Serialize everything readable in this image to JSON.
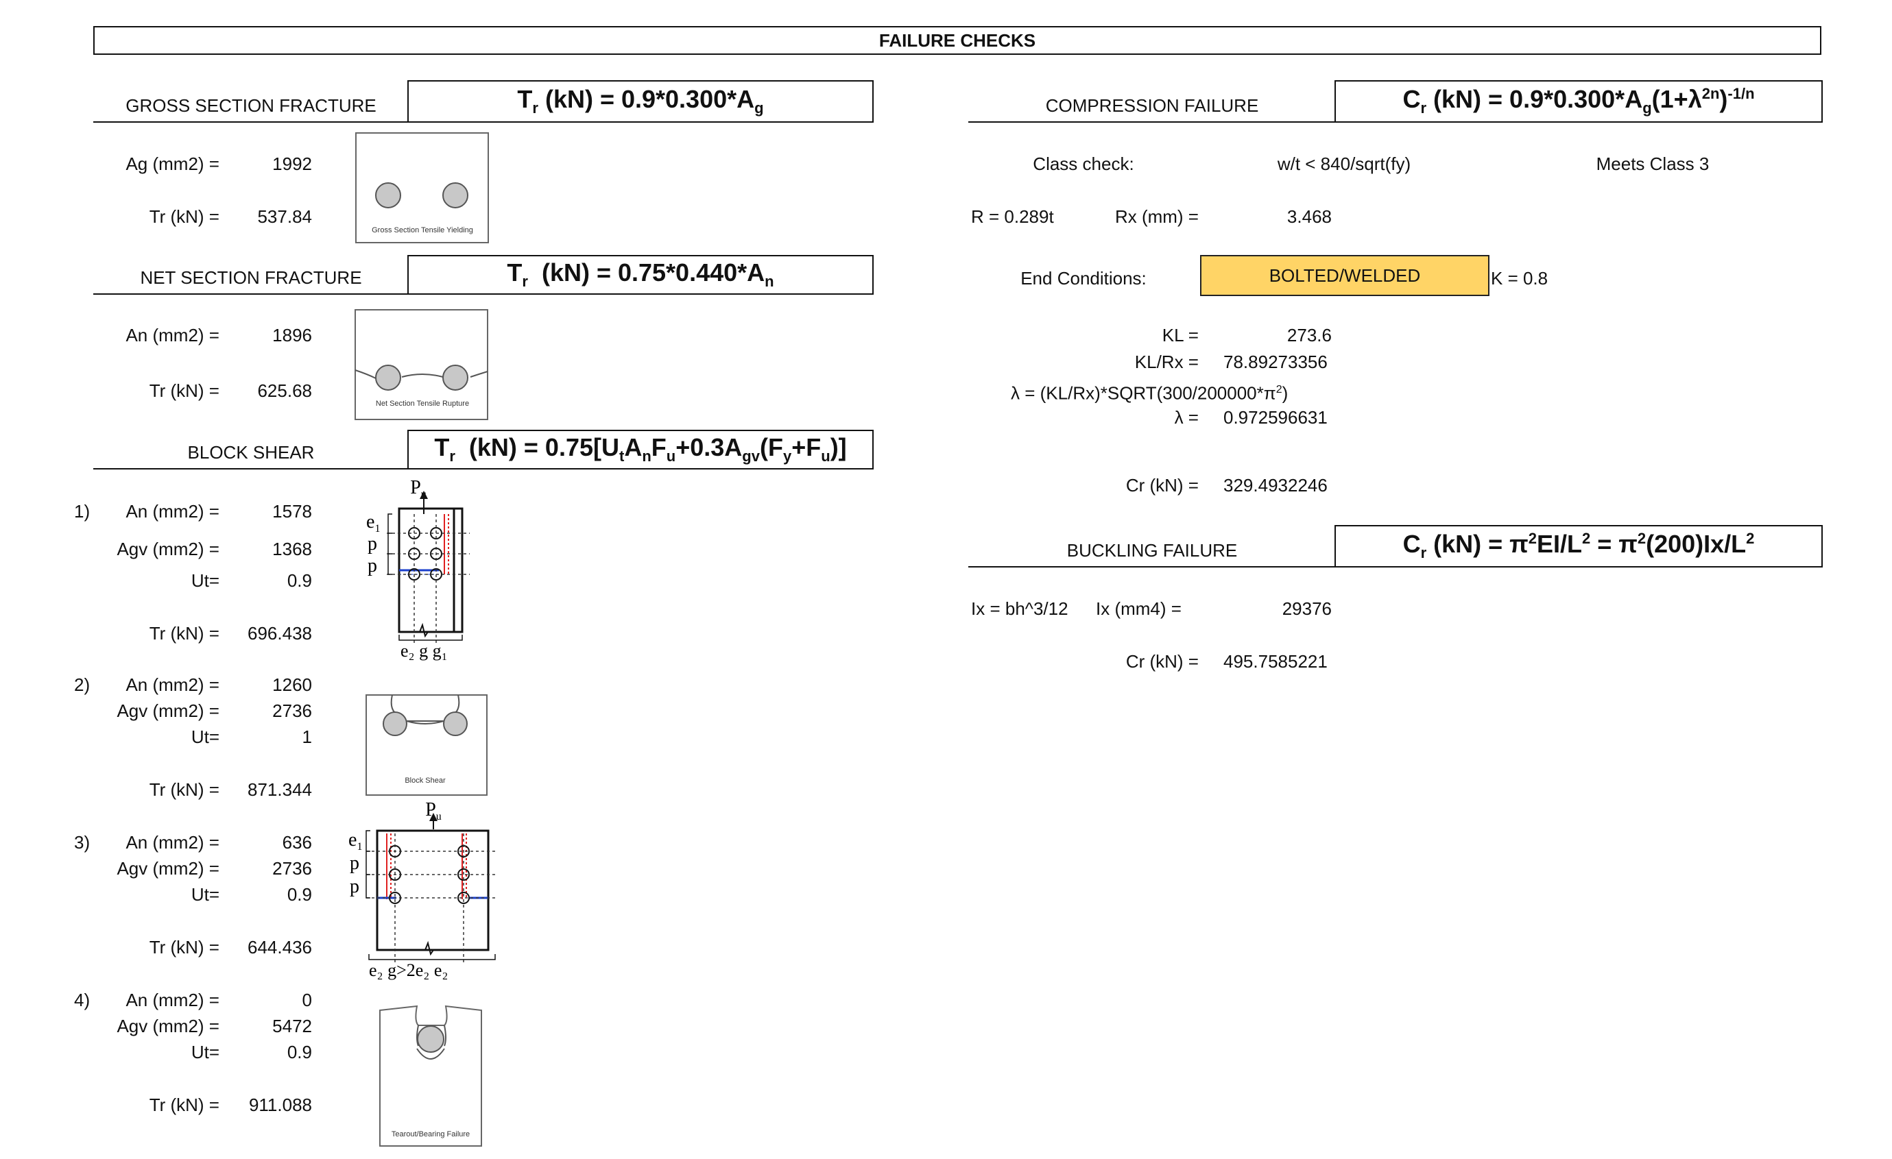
{
  "title": "FAILURE CHECKS",
  "gross": {
    "heading": "GROSS SECTION FRACTURE",
    "ag_label": "Ag (mm2) =",
    "ag_value": "1992",
    "tr_label": "Tr (kN) =",
    "tr_value": "537.84",
    "caption": "Gross Section Tensile Yielding"
  },
  "net": {
    "heading": "NET SECTION FRACTURE",
    "an_label": "An (mm2) =",
    "an_value": "1896",
    "tr_label": "Tr (kN) =",
    "tr_value": "625.68",
    "caption": "Net Section Tensile Rupture"
  },
  "block": {
    "heading": "BLOCK SHEAR",
    "cases": [
      {
        "num": "1)",
        "an_label": "An (mm2) =",
        "an": "1578",
        "agv_label": "Agv (mm2) =",
        "agv": "1368",
        "ut_label": "Ut=",
        "ut": "0.9",
        "tr_label": "Tr (kN) =",
        "tr": "696.438"
      },
      {
        "num": "2)",
        "an_label": "An (mm2) =",
        "an": "1260",
        "agv_label": "Agv (mm2) =",
        "agv": "2736",
        "ut_label": "Ut=",
        "ut": "1",
        "tr_label": "Tr (kN) =",
        "tr": "871.344"
      },
      {
        "num": "3)",
        "an_label": "An (mm2) =",
        "an": "636",
        "agv_label": "Agv (mm2) =",
        "agv": "2736",
        "ut_label": "Ut=",
        "ut": "0.9",
        "tr_label": "Tr (kN) =",
        "tr": "644.436"
      },
      {
        "num": "4)",
        "an_label": "An (mm2) =",
        "an": "0",
        "agv_label": "Agv (mm2) =",
        "agv": "5472",
        "ut_label": "Ut=",
        "ut": "0.9",
        "tr_label": "Tr (kN) =",
        "tr": "911.088"
      }
    ],
    "caption_block": "Block Shear",
    "caption_tearout": "Tearout/Bearing Failure",
    "diagram1": {
      "pu": "P",
      "pu_sub": "u",
      "e1": "e",
      "e1_sub": "1",
      "p": "p",
      "bottom": "e₂ g g₁"
    },
    "diagram3": {
      "pu": "P",
      "pu_sub": "u",
      "e1": "e",
      "e1_sub": "1",
      "p": "p",
      "bottom": "e₂ g>2e₂ e₂"
    }
  },
  "compression": {
    "heading": "COMPRESSION FAILURE",
    "class_label": "Class check:",
    "class_rule": "w/t < 840/sqrt(fy)",
    "class_result": "Meets Class 3",
    "r_label": "R = 0.289t",
    "rx_label": "Rx (mm) =",
    "rx_value": "3.468",
    "end_label": "End Conditions:",
    "end_value": "BOLTED/WELDED",
    "k_label": "K = 0.8",
    "kl_label": "KL =",
    "kl_value": "273.6",
    "klrx_label": "KL/Rx =",
    "klrx_value": "78.89273356",
    "lambda_formula": "λ = (KL/Rx)*SQRT(300/200000*π",
    "lambda_label": "λ =",
    "lambda_value": "0.972596631",
    "cr_label": "Cr (kN) =",
    "cr_value": "329.4932246"
  },
  "buckling": {
    "heading": "BUCKLING FAILURE",
    "ix_formula": "Ix = bh^3/12",
    "ix_label": "Ix (mm4) =",
    "ix_value": "29376",
    "cr_label": "Cr (kN) =",
    "cr_value": "495.7585221"
  },
  "colors": {
    "highlight": "#ffd466",
    "red": "#e02020",
    "blue": "#1a3fcc",
    "hole": "#c8c8c8"
  }
}
